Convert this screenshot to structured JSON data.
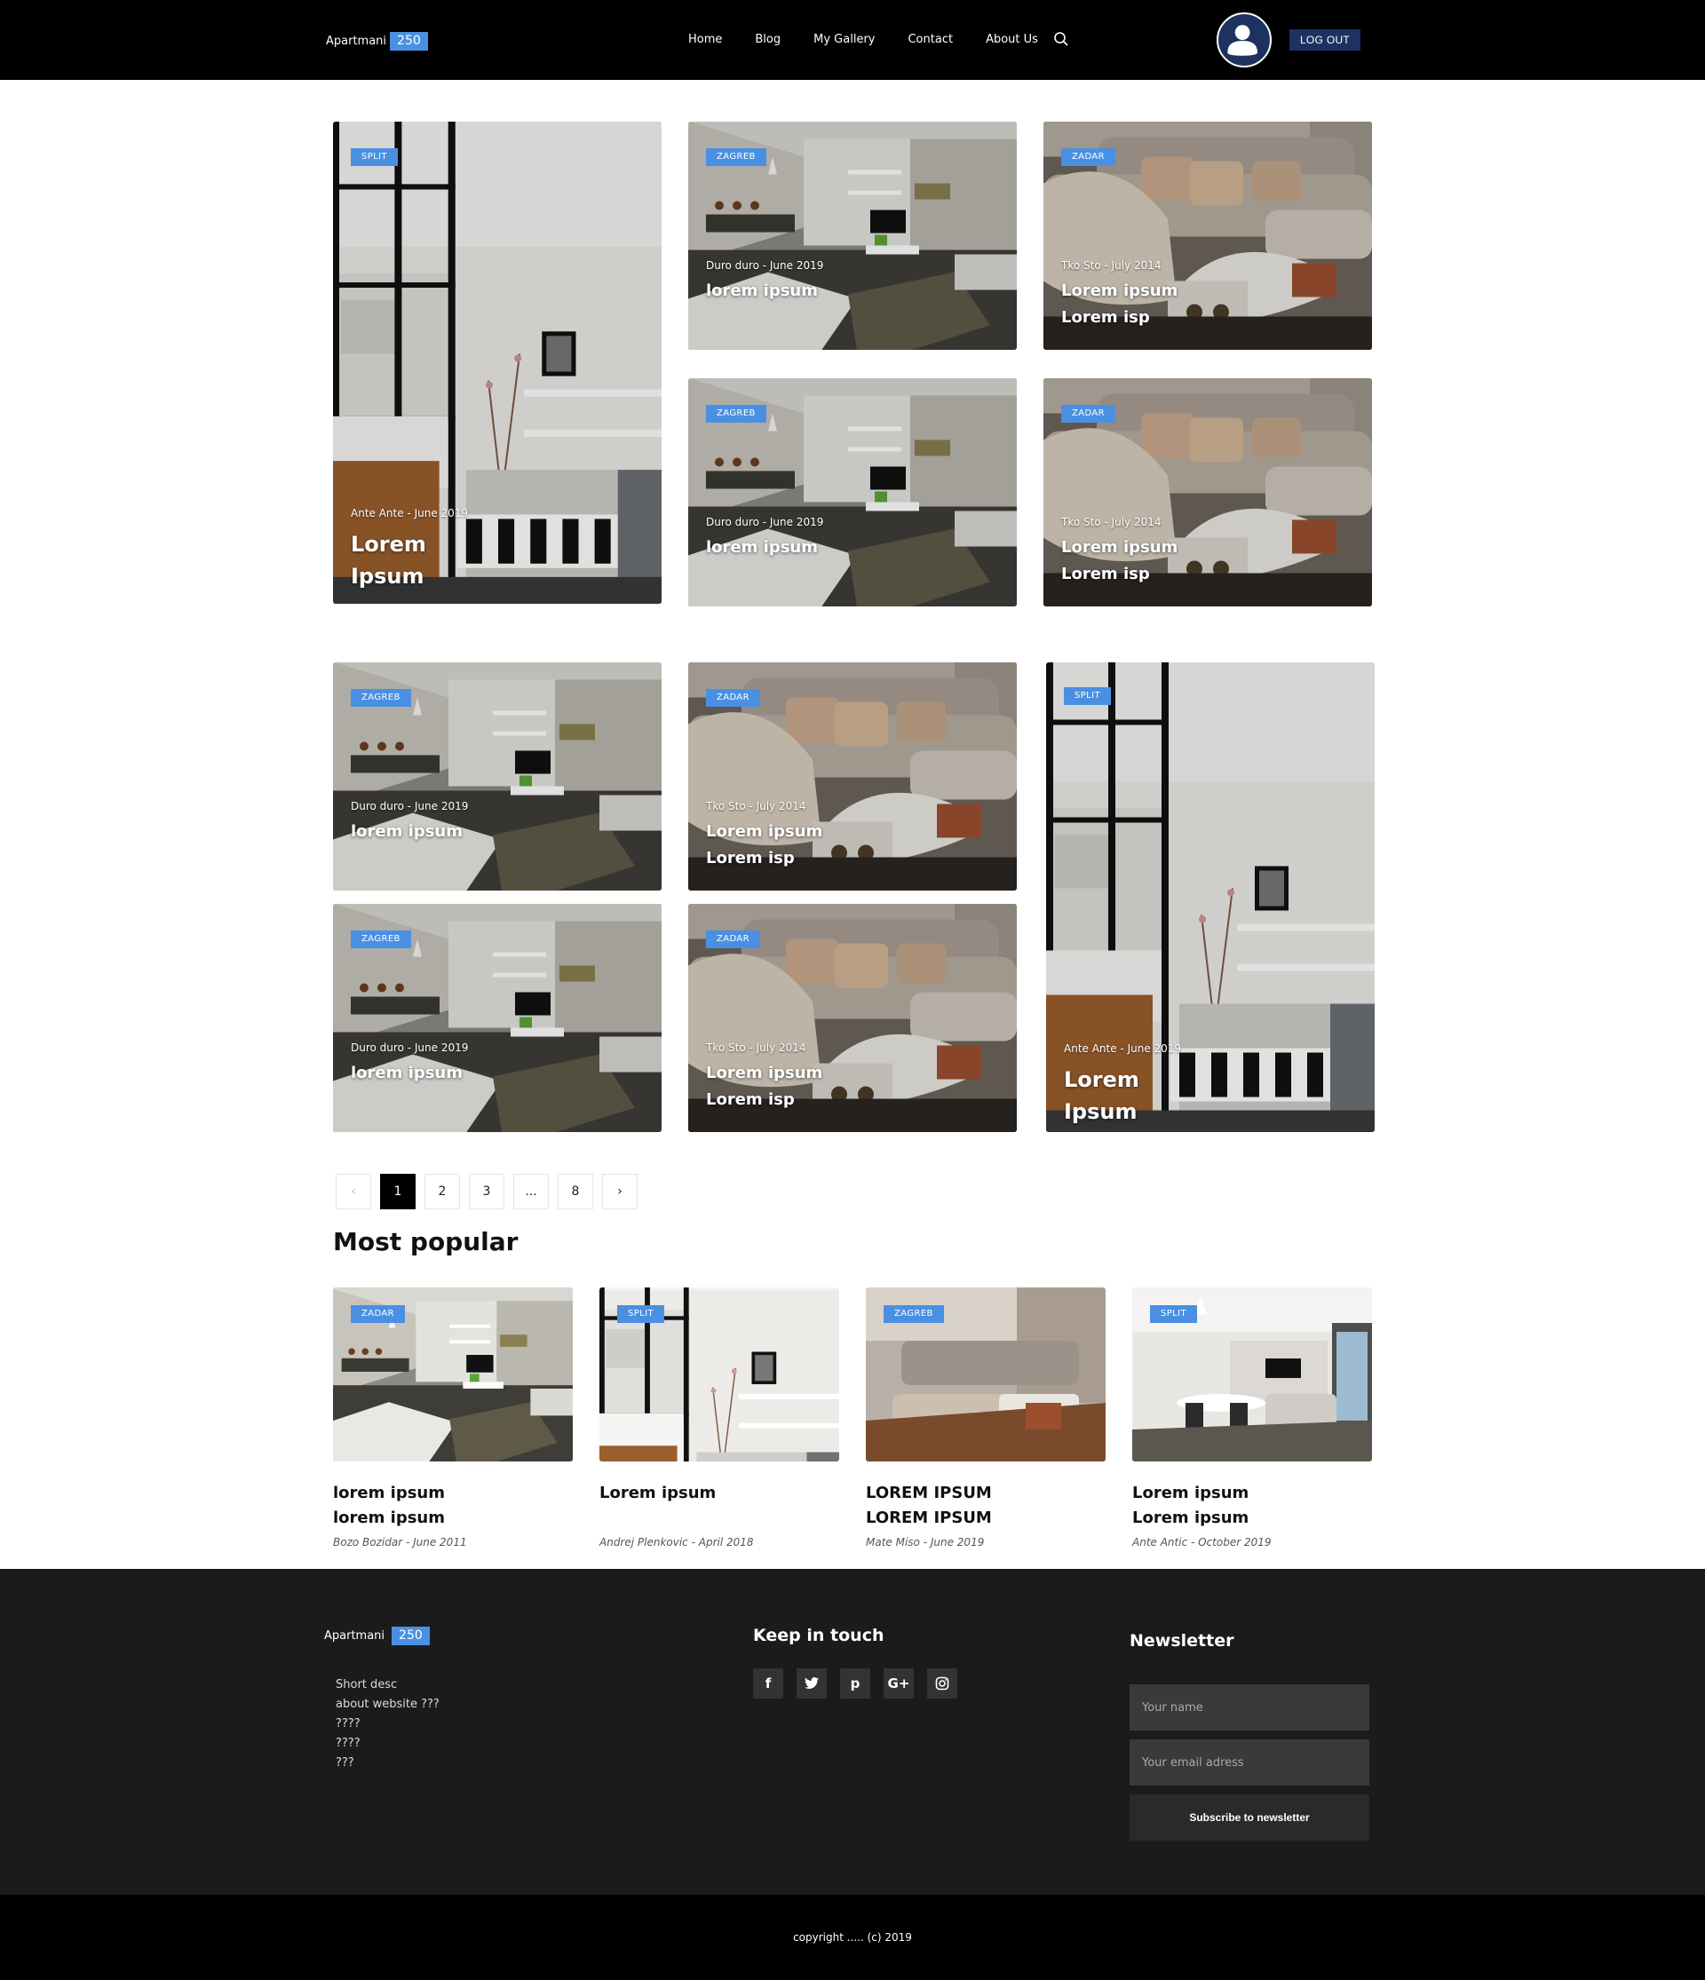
{
  "header": {
    "logo_text": "Apartmani",
    "logo_badge": "250",
    "nav": [
      "Home",
      "Blog",
      "My Gallery",
      "Contact",
      "About Us"
    ],
    "logout_label": "LOG OUT"
  },
  "cards": {
    "c1": {
      "tag": "SPLIT",
      "meta": "Ante Ante  - June 2019",
      "title": [
        "Lorem",
        "Ipsum"
      ]
    },
    "c2": {
      "tag": "ZAGREB",
      "meta": "Duro duro - June 2019",
      "title": [
        "lorem ipsum"
      ]
    },
    "c3": {
      "tag": "ZADAR",
      "meta": "Tko Sto - July 2014",
      "title": [
        "Lorem ipsum",
        "Lorem isp"
      ]
    },
    "c4": {
      "tag": "ZAGREB",
      "meta": "Duro duro - June 2019",
      "title": [
        "lorem ipsum"
      ]
    },
    "c5": {
      "tag": "ZADAR",
      "meta": "Tko Sto - July 2014",
      "title": [
        "Lorem ipsum",
        "Lorem isp"
      ]
    },
    "c6": {
      "tag": "ZAGREB",
      "meta": "Duro duro - June 2019",
      "title": [
        "lorem ipsum"
      ]
    },
    "c7": {
      "tag": "ZADAR",
      "meta": "Tko Sto - July 2014",
      "title": [
        "Lorem ipsum",
        "Lorem isp"
      ]
    },
    "c8": {
      "tag": "SPLIT",
      "meta": "Ante Ante  - June 2019",
      "title": [
        "Lorem",
        "Ipsum"
      ]
    },
    "c9": {
      "tag": "ZAGREB",
      "meta": "Duro duro - June 2019",
      "title": [
        "lorem ipsum"
      ]
    },
    "c10": {
      "tag": "ZADAR",
      "meta": "Tko Sto - July 2014",
      "title": [
        "Lorem ipsum",
        "Lorem isp"
      ]
    }
  },
  "pagination": {
    "prev": "‹",
    "pages": [
      "1",
      "2",
      "3",
      "...",
      "8"
    ],
    "next": "›",
    "active": "1"
  },
  "popular": {
    "title": "Most popular",
    "items": [
      {
        "tag": "ZADAR",
        "title": [
          "lorem ipsum",
          "lorem ipsum"
        ],
        "meta": "Bozo Bozidar - June 2011"
      },
      {
        "tag": "SPLIT",
        "title": [
          "Lorem ipsum"
        ],
        "meta": "Andrej Plenkovic - April 2018"
      },
      {
        "tag": "ZAGREB",
        "title": [
          "LOREM IPSUM",
          "LOREM IPSUM"
        ],
        "meta": "Mate Miso - June 2019"
      },
      {
        "tag": "SPLIT",
        "title": [
          "Lorem ipsum",
          "Lorem ipsum"
        ],
        "meta": "Ante Antic -  October 2019"
      }
    ]
  },
  "footer": {
    "logo_text": "Apartmani",
    "logo_badge": "250",
    "desc": [
      "Short desc",
      "about website ???",
      "????",
      "????",
      "???"
    ],
    "keep_title": "Keep in touch",
    "socials": [
      "f",
      "t",
      "p",
      "G+",
      "ig"
    ],
    "newsletter_title": "Newsletter",
    "name_placeholder": "Your name",
    "email_placeholder": "Your email adress",
    "subscribe_label": "Subscribe to newsletter",
    "copyright": "copyright ..... (c) 2019"
  },
  "colors": {
    "accent": "#4a90e2",
    "navy": "#1d3261",
    "footer_bg": "#1b1b1b"
  }
}
